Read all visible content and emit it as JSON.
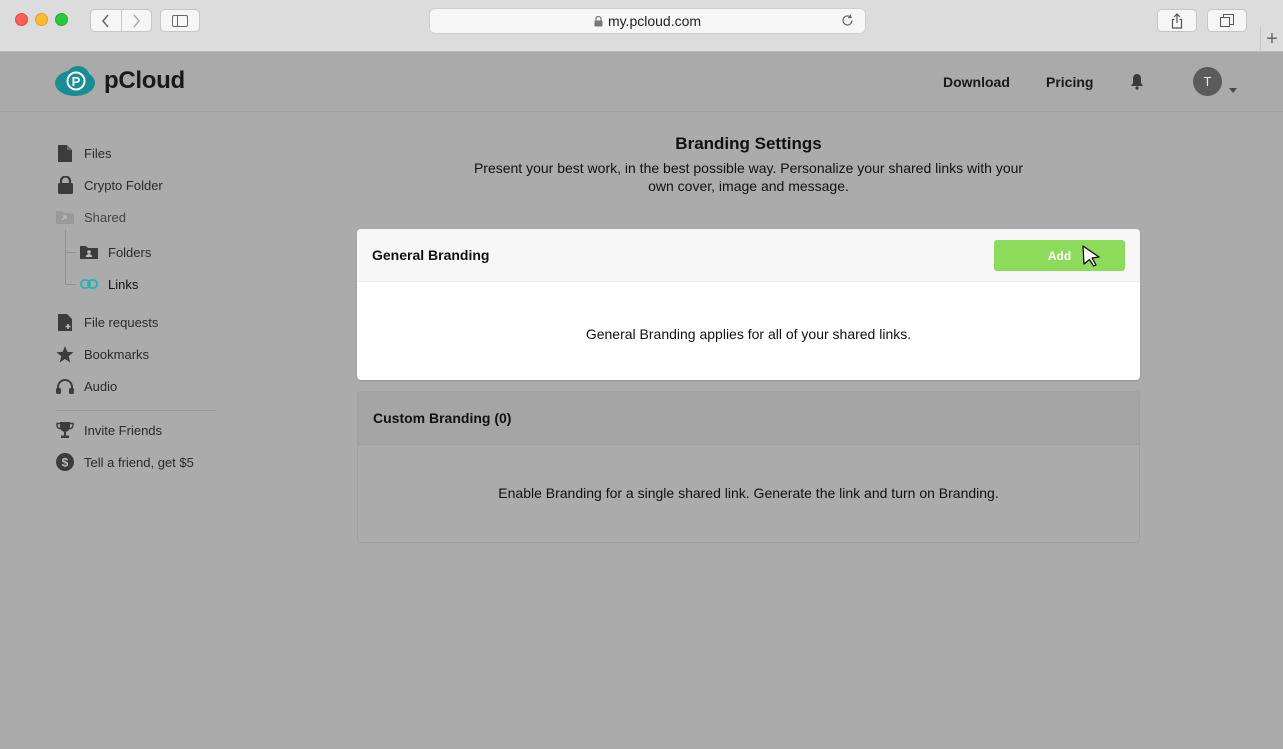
{
  "browser": {
    "url": "my.pcloud.com"
  },
  "header": {
    "brand": "pCloud",
    "download_label": "Download",
    "pricing_label": "Pricing",
    "avatar_initial": "T"
  },
  "sidebar": {
    "files": "Files",
    "crypto_folder": "Crypto Folder",
    "shared": "Shared",
    "folders": "Folders",
    "links": "Links",
    "file_requests": "File requests",
    "bookmarks": "Bookmarks",
    "audio": "Audio",
    "invite_friends": "Invite Friends",
    "tell_friend": "Tell a friend, get $5"
  },
  "main": {
    "title": "Branding Settings",
    "subtitle": "Present your best work, in the best possible way. Personalize your shared links with your own cover, image and message.",
    "general": {
      "heading": "General Branding",
      "add_label": "Add",
      "body": "General Branding applies for all of your shared links."
    },
    "custom": {
      "heading": "Custom Branding (0)",
      "body": "Enable Branding for a single shared link. Generate the link and turn on Branding."
    }
  },
  "colors": {
    "accent_green": "#8ddb5b",
    "link_teal": "#1cb5b0",
    "overlay_gray": "#ababab"
  }
}
